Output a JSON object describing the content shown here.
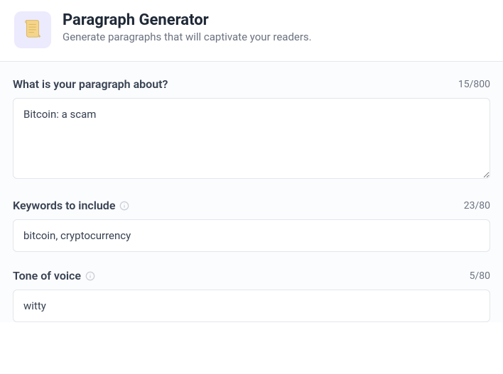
{
  "header": {
    "title": "Paragraph Generator",
    "subtitle": "Generate paragraphs that will captivate your readers."
  },
  "fields": {
    "about": {
      "label": "What is your paragraph about?",
      "value": "Bitcoin: a scam",
      "counter": "15/800"
    },
    "keywords": {
      "label": "Keywords to include",
      "value": "bitcoin, cryptocurrency",
      "counter": "23/80"
    },
    "tone": {
      "label": "Tone of voice",
      "value": "witty",
      "counter": "5/80"
    }
  }
}
